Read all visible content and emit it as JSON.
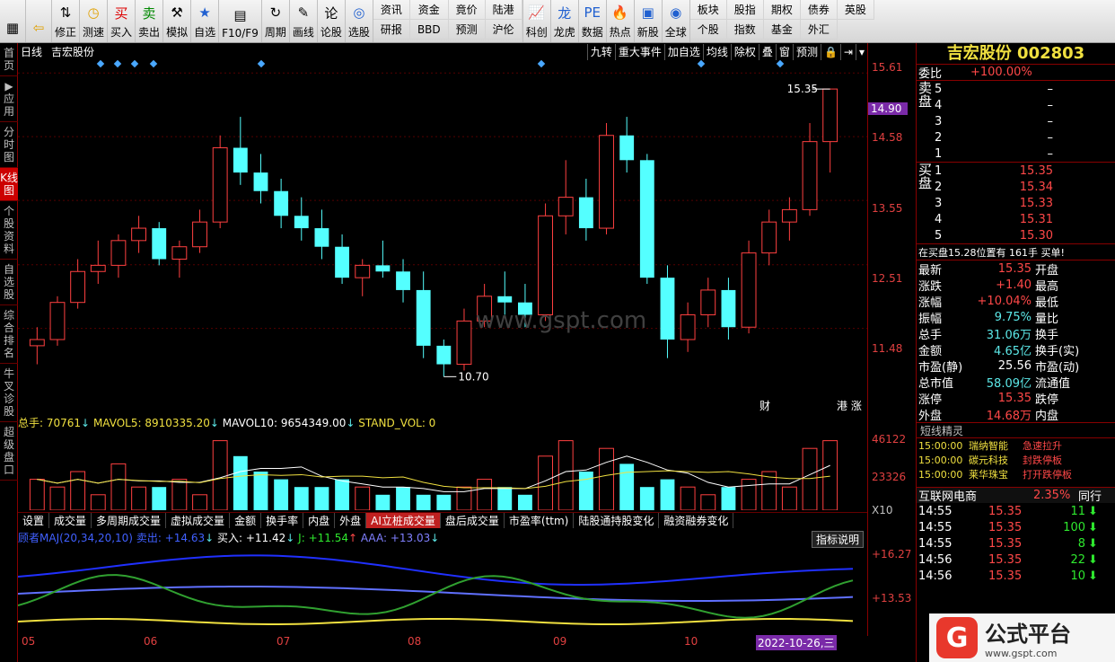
{
  "toolbar": {
    "buttons": [
      {
        "label": "",
        "icon": "win-logo-icon"
      },
      {
        "label": "",
        "icon": "back-arrow-icon"
      },
      {
        "label": "修正",
        "icon": "arrow-updown-icon"
      },
      {
        "label": "测速",
        "icon": "clock-icon"
      },
      {
        "label": "买入",
        "icon": "buy-icon"
      },
      {
        "label": "卖出",
        "icon": "sell-icon"
      },
      {
        "label": "模拟",
        "icon": "hammer-icon"
      },
      {
        "label": "自选",
        "icon": "star-icon"
      },
      {
        "label": "F10/F9",
        "icon": "doc-icon"
      },
      {
        "label": "周期",
        "icon": "period-icon"
      },
      {
        "label": "画线",
        "icon": "pen-icon"
      },
      {
        "label": "论股",
        "icon": "discuss-icon"
      },
      {
        "label": "选股",
        "icon": "select-icon"
      }
    ],
    "grid1": [
      "资讯",
      "资金",
      "竟价",
      "陆港",
      "研报",
      "BBD",
      "预测",
      "沪伦"
    ],
    "buttons2": [
      {
        "label": "科创",
        "icon": "chart-icon"
      },
      {
        "label": "龙虎",
        "icon": "tiger-icon"
      },
      {
        "label": "数据",
        "icon": "pe-icon"
      },
      {
        "label": "热点",
        "icon": "hot-icon"
      },
      {
        "label": "新股",
        "icon": "newstock-icon"
      },
      {
        "label": "全球",
        "icon": "globe-icon"
      }
    ],
    "grid2": [
      "板块",
      "股指",
      "期权",
      "债券",
      "英股",
      "个股",
      "指数",
      "基金",
      "外汇"
    ]
  },
  "left_tabs": [
    "首页",
    "▶应用",
    "分时图",
    "K线图",
    "个股资料",
    "自选股",
    "综合排名",
    "牛叉诊股",
    "超级盘口"
  ],
  "chart": {
    "period": "日线",
    "name": "吉宏股份",
    "buttons": [
      "九转",
      "重大事件",
      "加自选",
      "均线",
      "除权",
      "叠",
      "窗",
      "预测",
      "🔒",
      "⇥",
      "▾"
    ],
    "high_label": "15.35",
    "low_label": "10.70",
    "price_tag": "14.90",
    "fin_tag": "财",
    "hk_tag": "港 涨",
    "watermark": "www.gspt.com"
  },
  "yaxis": [
    "15.61",
    "14.58",
    "13.55",
    "12.51",
    "11.48",
    "46122",
    "23326",
    "X10",
    "+16.27",
    "+13.53"
  ],
  "volume": {
    "total": "总手: 70761",
    "ma5": "MAVOL5: 8910335.20",
    "ma10": "MAVOL10: 9654349.00",
    "std": "STAND_VOL: 0"
  },
  "subtabs": [
    "设置",
    "成交量",
    "多周期成交量",
    "虚拟成交量",
    "金额",
    "换手率",
    "内盘",
    "外盘",
    "AI立桩成交量",
    "盘后成交量",
    "市盈率(ttm)",
    "陆股通持股变化",
    "融资融券变化"
  ],
  "indicator": {
    "name": "顾者MAJ(20,34,20,10)",
    "sell": "卖出: +14.63",
    "buy": "买入: +11.42",
    "j": "J: +11.54",
    "aaa": "AAA: +13.03",
    "help": "指标说明"
  },
  "xaxis": [
    "05",
    "06",
    "07",
    "08",
    "09",
    "10",
    "2022-10-26,三"
  ],
  "quote": {
    "title": "吉宏股份 002803",
    "weibi_label": "委比",
    "weibi": "+100.00%",
    "sell_label": "卖盘",
    "buy_label": "买盘",
    "sells": [
      {
        "n": "5",
        "p": "–",
        "v": ""
      },
      {
        "n": "4",
        "p": "–",
        "v": ""
      },
      {
        "n": "3",
        "p": "–",
        "v": ""
      },
      {
        "n": "2",
        "p": "–",
        "v": ""
      },
      {
        "n": "1",
        "p": "–",
        "v": ""
      }
    ],
    "buys": [
      {
        "n": "1",
        "p": "15.35",
        "v": ""
      },
      {
        "n": "2",
        "p": "15.34",
        "v": ""
      },
      {
        "n": "3",
        "p": "15.33",
        "v": ""
      },
      {
        "n": "4",
        "p": "15.31",
        "v": ""
      },
      {
        "n": "5",
        "p": "15.30",
        "v": ""
      }
    ],
    "notice": "在买盘15.28位置有 161手 买单!",
    "stats": [
      {
        "l": "最新",
        "v": "15.35",
        "l2": "开盘",
        "c": "red"
      },
      {
        "l": "涨跌",
        "v": "+1.40",
        "l2": "最高",
        "c": "red"
      },
      {
        "l": "涨幅",
        "v": "+10.04%",
        "l2": "最低",
        "c": "red"
      },
      {
        "l": "振幅",
        "v": "9.75%",
        "l2": "量比",
        "c": "cyn"
      },
      {
        "l": "总手",
        "v": "31.06万",
        "l2": "换手",
        "c": "cyn"
      },
      {
        "l": "金额",
        "v": "4.65亿",
        "l2": "换手(实)",
        "c": "cyn"
      },
      {
        "l": "市盈(静)",
        "v": "25.56",
        "l2": "市盈(动)",
        "c": "wht"
      },
      {
        "l": "总市值",
        "v": "58.09亿",
        "l2": "流通值",
        "c": "cyn"
      },
      {
        "l": "涨停",
        "v": "15.35",
        "l2": "跌停",
        "c": "red"
      },
      {
        "l": "外盘",
        "v": "14.68万",
        "l2": "内盘",
        "c": "red"
      }
    ],
    "elf_title": "短线精灵",
    "elf": [
      {
        "t": "15:00:00",
        "n": "瑞纳智能",
        "e": "急速拉升"
      },
      {
        "t": "15:00:00",
        "n": "碳元科技",
        "e": "封跌停板"
      },
      {
        "t": "15:00:00",
        "n": "莱华珠宝",
        "e": "打开跌停板"
      }
    ],
    "sector": "互联网电商",
    "sector_pct": "2.35%",
    "sector_more": "同行",
    "ticks": [
      {
        "t": "14:55",
        "p": "15.35",
        "v": "11"
      },
      {
        "t": "14:55",
        "p": "15.35",
        "v": "100"
      },
      {
        "t": "14:55",
        "p": "15.35",
        "v": "8"
      },
      {
        "t": "14:56",
        "p": "15.35",
        "v": "22"
      },
      {
        "t": "14:56",
        "p": "15.35",
        "v": "10"
      }
    ],
    "logo_text": "公式平台",
    "logo_url": "www.gspt.com"
  },
  "chart_data": {
    "type": "candlestick",
    "ylim": [
      10.4,
      15.7
    ],
    "ohlc": [
      [
        11.2,
        11.5,
        10.9,
        11.3
      ],
      [
        11.3,
        12.0,
        11.2,
        11.9
      ],
      [
        11.9,
        12.6,
        11.8,
        12.4
      ],
      [
        12.4,
        12.9,
        12.2,
        12.5
      ],
      [
        12.5,
        13.0,
        12.3,
        12.9
      ],
      [
        12.9,
        13.3,
        12.7,
        13.1
      ],
      [
        13.1,
        13.2,
        12.5,
        12.6
      ],
      [
        12.6,
        12.9,
        12.3,
        12.8
      ],
      [
        12.8,
        13.4,
        12.7,
        13.2
      ],
      [
        13.2,
        14.6,
        13.1,
        14.4
      ],
      [
        14.4,
        14.9,
        13.8,
        14.0
      ],
      [
        14.0,
        14.3,
        13.5,
        13.7
      ],
      [
        13.7,
        13.9,
        13.1,
        13.3
      ],
      [
        13.3,
        13.6,
        12.9,
        13.1
      ],
      [
        13.1,
        13.4,
        12.6,
        12.8
      ],
      [
        12.8,
        13.0,
        12.2,
        12.3
      ],
      [
        12.3,
        12.6,
        12.0,
        12.5
      ],
      [
        12.5,
        12.9,
        12.3,
        12.4
      ],
      [
        12.4,
        12.6,
        11.9,
        12.1
      ],
      [
        12.1,
        12.4,
        11.0,
        11.2
      ],
      [
        11.2,
        11.3,
        10.7,
        10.9
      ],
      [
        10.9,
        11.8,
        10.8,
        11.6
      ],
      [
        11.6,
        12.2,
        11.5,
        12.0
      ],
      [
        12.0,
        12.4,
        11.7,
        11.9
      ],
      [
        11.9,
        12.2,
        11.5,
        11.7
      ],
      [
        11.7,
        13.5,
        11.6,
        13.3
      ],
      [
        13.3,
        14.2,
        13.0,
        13.6
      ],
      [
        13.6,
        13.9,
        12.9,
        13.1
      ],
      [
        13.1,
        14.8,
        13.0,
        14.6
      ],
      [
        14.6,
        14.9,
        14.0,
        14.2
      ],
      [
        14.2,
        14.3,
        12.2,
        12.3
      ],
      [
        12.3,
        12.5,
        11.0,
        11.3
      ],
      [
        11.3,
        11.9,
        11.1,
        11.7
      ],
      [
        11.7,
        12.3,
        11.5,
        12.1
      ],
      [
        12.1,
        12.3,
        11.3,
        11.5
      ],
      [
        11.5,
        12.9,
        11.4,
        12.7
      ],
      [
        12.7,
        13.4,
        12.5,
        13.2
      ],
      [
        13.2,
        13.6,
        12.9,
        13.4
      ],
      [
        13.4,
        14.8,
        13.3,
        14.5
      ],
      [
        14.5,
        15.35,
        14.0,
        15.35
      ]
    ]
  }
}
